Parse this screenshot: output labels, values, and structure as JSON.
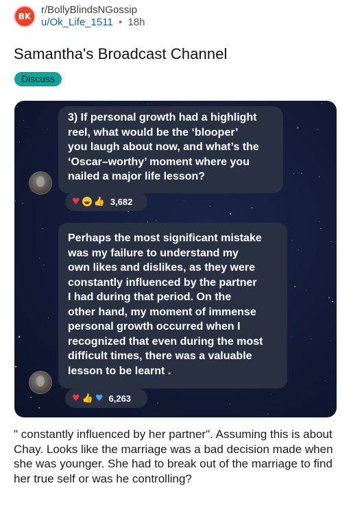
{
  "post": {
    "subreddit": "r/BollyBlindsNGossip",
    "subreddit_avatar_text": "BK",
    "username": "u/Ok_Life_1511",
    "separator": "•",
    "age": "18h",
    "title": "Samantha's Broadcast Channel",
    "flair": "Discuss",
    "body": "\" constantly influenced by her partner\". Assuming this is about Chay. Looks like the marriage was a bad decision made when she was younger. She had to break out of the marriage to find her true self or was he controlling?"
  },
  "screenshot": {
    "messages": [
      {
        "lines": [
          "3) If personal growth had a highlight",
          "reel, what would be the ‘blooper’",
          "you laugh about now, and what’s the",
          "‘Oscar–worthy’ moment where you",
          "nailed a major life lesson?"
        ],
        "reactions": {
          "emojis": [
            "heart-icon",
            "grinning-face-icon",
            "thumbs-up-icon"
          ],
          "count": "3,682"
        }
      },
      {
        "lines": [
          "Perhaps the most significant mistake",
          "was my failure to understand my",
          "own likes and dislikes, as they were",
          "constantly influenced by the partner",
          "I had during that period. On the",
          "other hand, my moment of immense",
          "personal growth occurred when I",
          "recognized that even during the most",
          "difficult times, there was a valuable",
          "lesson to be learnt ."
        ],
        "reactions": {
          "emojis": [
            "heart-icon",
            "thumbs-up-icon",
            "blue-heart-icon"
          ],
          "count": "6,263"
        }
      }
    ]
  },
  "colors": {
    "flair_bg": "#0fa39b",
    "username": "#0b63b8",
    "bubble_bg": "#283042",
    "chat_bg": "#121a36"
  }
}
